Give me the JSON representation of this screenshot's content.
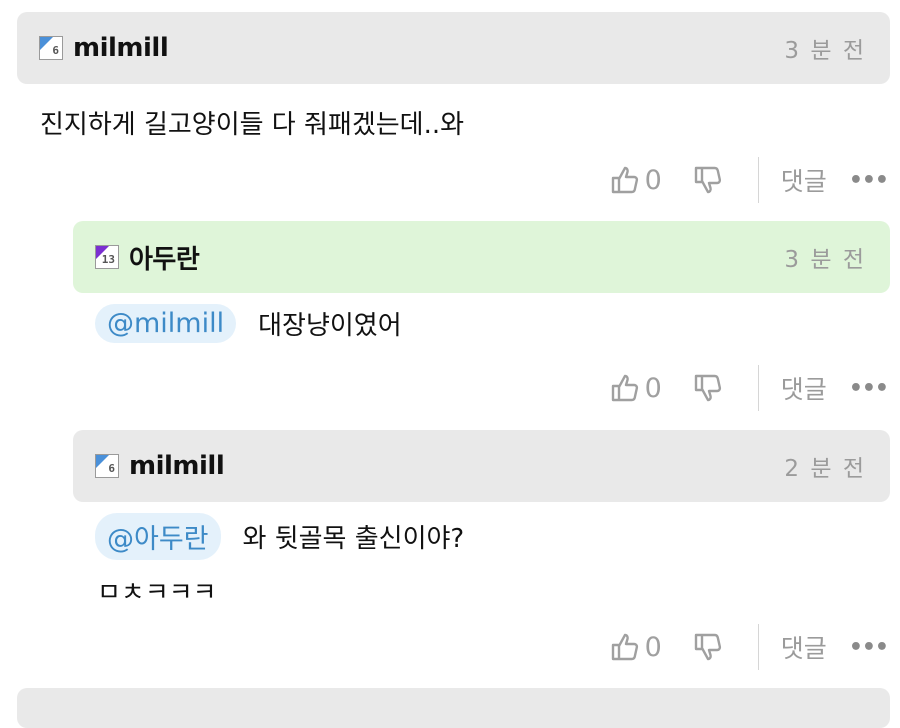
{
  "comments": [
    {
      "nickname": "milmill",
      "level": "6",
      "time": "3 분 전",
      "text": "진지하게 길고양이들 다 줘패겠는데..와",
      "likes": "0",
      "reply_label": "댓글",
      "more_label": "•••"
    },
    {
      "nickname": "아두란",
      "level": "13",
      "time": "3 분 전",
      "mention": "@milmill",
      "text": "대장냥이였어",
      "likes": "0",
      "reply_label": "댓글",
      "more_label": "•••"
    },
    {
      "nickname": "milmill",
      "level": "6",
      "time": "2 분 전",
      "mention": "@아두란",
      "text": "와 뒷골목 출신이야?",
      "text2": "ㅁㅊㅋㅋㅋ",
      "likes": "0",
      "reply_label": "댓글",
      "more_label": "•••"
    }
  ],
  "colors": {
    "header_gray": "#e9e9e9",
    "header_green": "#dff5d9",
    "mention_text": "#3d8ac7",
    "mention_bg": "#e4f1fb"
  },
  "icons": {
    "like": "thumbs-up-icon",
    "dislike": "thumbs-down-icon",
    "level": "level-badge-icon"
  }
}
